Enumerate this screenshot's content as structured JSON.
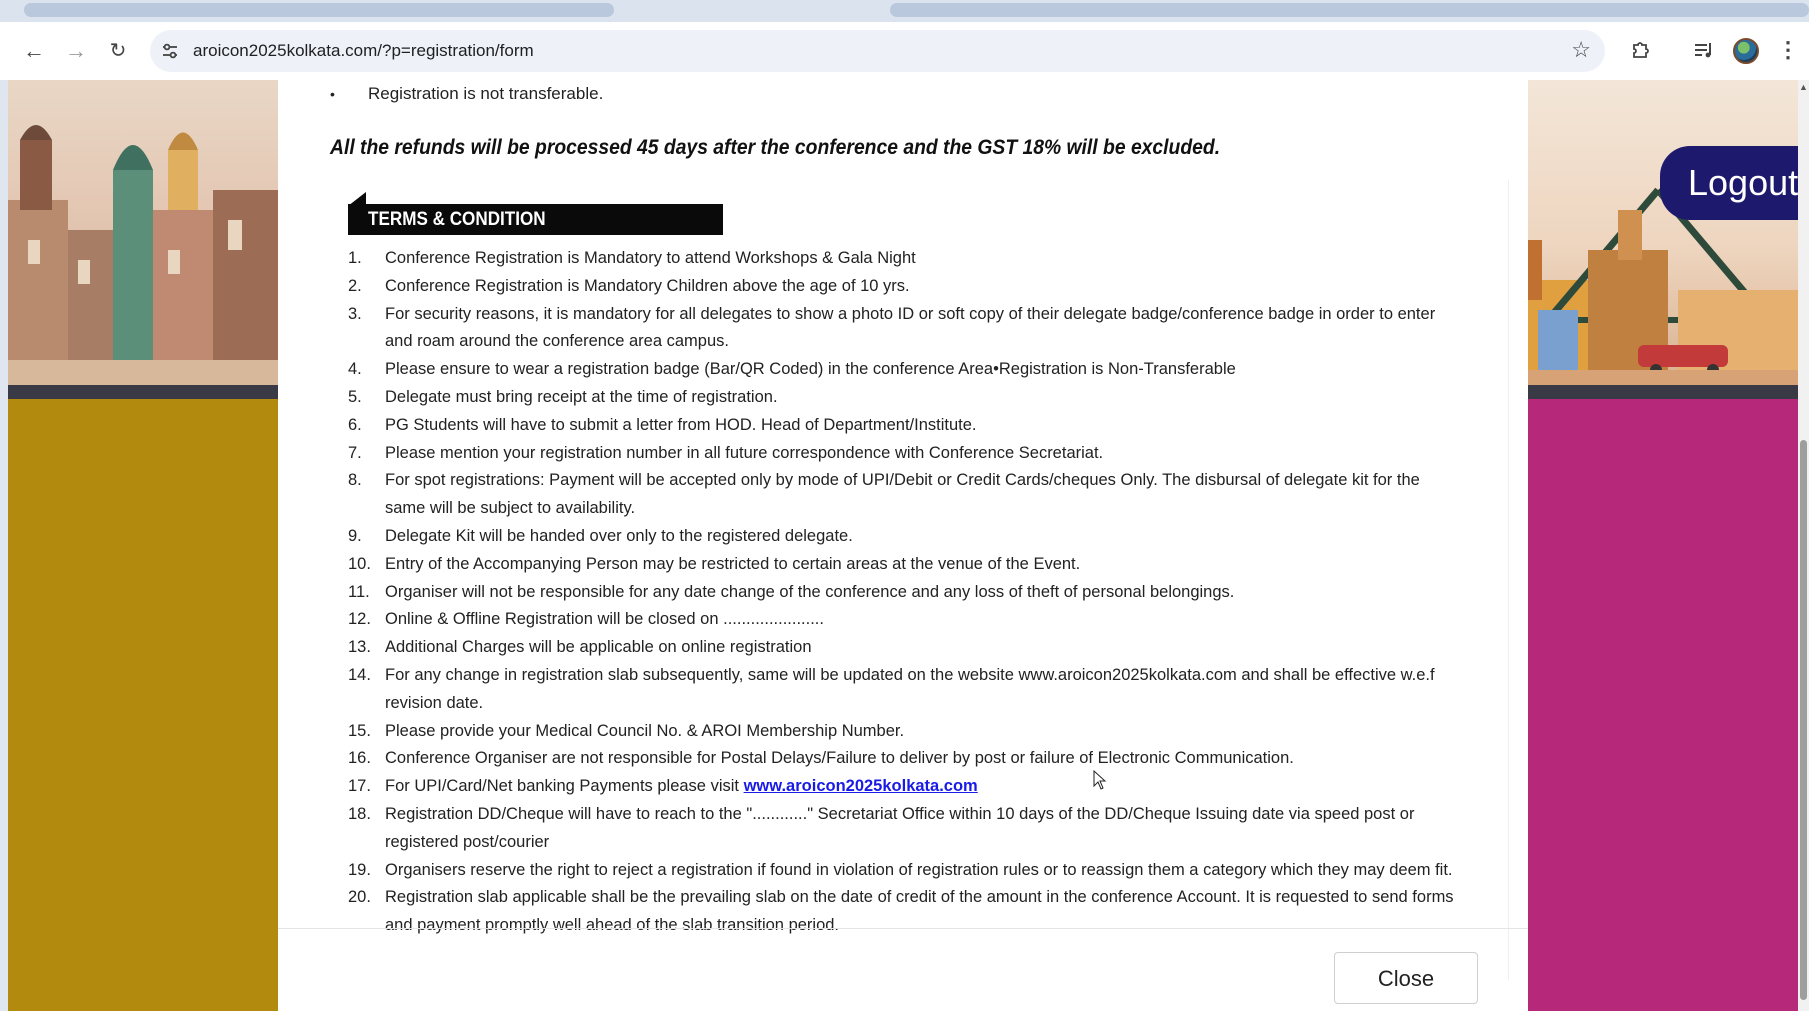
{
  "browser": {
    "url": "aroicon2025kolkata.com/?p=registration/form"
  },
  "page": {
    "logout_label": "Logout",
    "colors": {
      "left_panel": "#b28a0d",
      "right_panel": "#b5287a",
      "logout_bg": "#1d1a6e"
    }
  },
  "modal": {
    "prev_bullet": "Registration is not transferable.",
    "refund_note": "All the refunds will be processed 45 days after the conference and the GST 18% will be excluded.",
    "terms_title": "TERMS & CONDITION",
    "terms": [
      {
        "num": "1.",
        "text": "Conference Registration is Mandatory to attend Workshops & Gala Night"
      },
      {
        "num": "2.",
        "text": "Conference Registration is Mandatory Children above the age of 10 yrs."
      },
      {
        "num": "3.",
        "text": "For security reasons, it is mandatory for all delegates to show a photo ID or soft copy of their delegate badge/conference badge in order to enter and roam around the conference area campus."
      },
      {
        "num": "4.",
        "text": "Please ensure to wear a registration badge (Bar/QR Coded) in the conference Area•Registration is Non-Transferable"
      },
      {
        "num": "5.",
        "text": "Delegate must bring receipt at the time of registration."
      },
      {
        "num": "6.",
        "text": "PG Students will have to submit a letter from HOD. Head of Department/Institute."
      },
      {
        "num": "7.",
        "text": "Please mention your registration number in all future correspondence with Conference Secretariat."
      },
      {
        "num": "8.",
        "text": "For spot registrations: Payment will be accepted only by mode of UPI/Debit or Credit Cards/cheques Only. The disbursal of delegate kit for the same will be subject to availability."
      },
      {
        "num": "9.",
        "text": "Delegate Kit will be handed over only to the registered delegate."
      },
      {
        "num": "10.",
        "text": "Entry of the Accompanying Person may be restricted to certain areas at the venue of the Event."
      },
      {
        "num": "11.",
        "text": "Organiser will not be responsible for any date change of the conference and any loss of theft of personal belongings."
      },
      {
        "num": "12.",
        "text": "Online & Offline Registration will be closed on ......................"
      },
      {
        "num": "13.",
        "text": "Additional Charges will be applicable on online registration"
      },
      {
        "num": "14.",
        "text": "For any change in registration slab subsequently, same will be updated on the website www.aroicon2025kolkata.com and shall be effective w.e.f revision date."
      },
      {
        "num": "15.",
        "text": "Please provide your Medical Council No. & AROI Membership Number."
      },
      {
        "num": "16.",
        "text": "Conference Organiser are not responsible for Postal Delays/Failure to deliver by post or failure of Electronic Communication."
      },
      {
        "num": "17.",
        "text": "For UPI/Card/Net banking Payments please visit ",
        "link": "www.aroicon2025kolkata.com"
      },
      {
        "num": "18.",
        "text": "Registration DD/Cheque will have to reach to the \"............\" Secretariat Office within 10 days of the DD/Cheque Issuing date via speed post or registered post/courier"
      },
      {
        "num": "19.",
        "text": "Organisers reserve the right to reject a registration if found in violation of registration rules or to reassign them a category which they may deem fit."
      },
      {
        "num": "20.",
        "text": "Registration slab applicable shall be the prevailing slab on the date of credit of the amount in the conference Account. It is requested to send forms and payment promptly well ahead of the slab transition period."
      }
    ],
    "close_label": "Close"
  }
}
